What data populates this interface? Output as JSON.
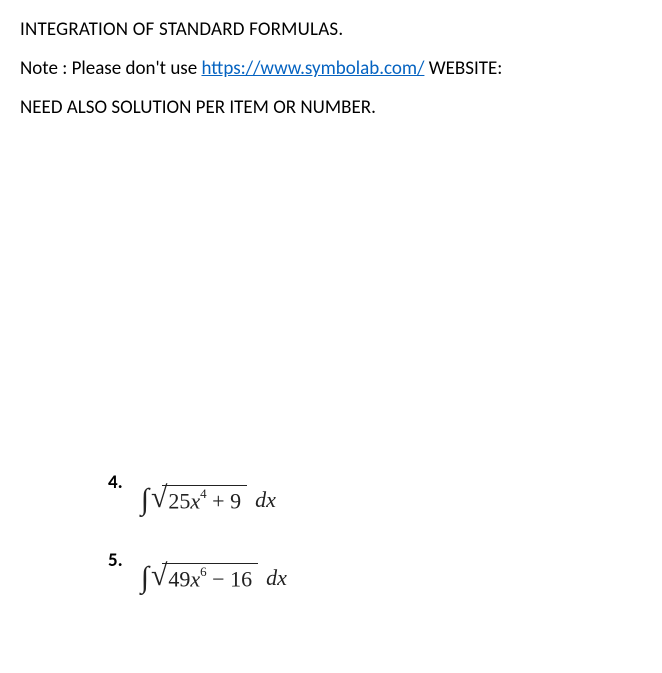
{
  "heading": "INTEGRATION OF STANDARD FORMULAS.",
  "note": {
    "prefix": "Note : Please don't use ",
    "link_text": "https://www.symbolab.com/",
    "link_href": "https://www.symbolab.com/",
    "suffix": " WEBSITE:"
  },
  "need_line": "NEED ALSO SOLUTION PER ITEM OR NUMBER.",
  "problems": [
    {
      "number": "4.",
      "coef": "25",
      "var": "x",
      "exp": "4",
      "op": "+",
      "const": "9",
      "dx": "dx"
    },
    {
      "number": "5.",
      "coef": "49",
      "var": "x",
      "exp": "6",
      "op": "−",
      "const": "16",
      "dx": "dx"
    }
  ]
}
